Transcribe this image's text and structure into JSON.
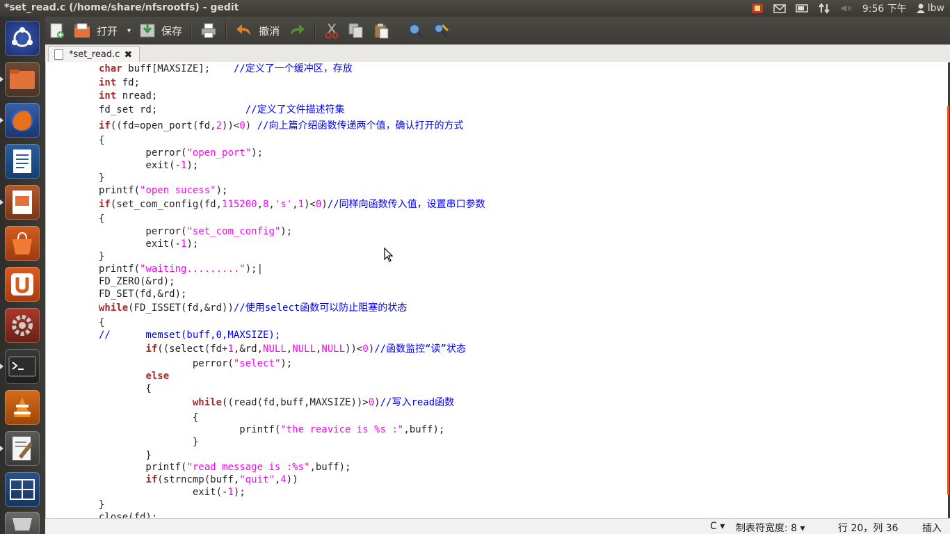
{
  "window": {
    "title": "*set_read.c (/home/share/nfsrootfs) - gedit"
  },
  "tray": {
    "time": "9:56 下午",
    "user": "lbw"
  },
  "toolbar": {
    "open_label": "打开",
    "save_label": "保存",
    "undo_label": "撤消"
  },
  "tab": {
    "name": "*set_read.c"
  },
  "code_lines": [
    {
      "tokens": [
        {
          "t": "char",
          "c": "kw"
        },
        {
          "t": " buff[MAXSIZE];    ",
          "c": ""
        },
        {
          "t": "//定义了一个缓冲区，存放",
          "c": "cm"
        }
      ]
    },
    {
      "tokens": [
        {
          "t": "int",
          "c": "kw"
        },
        {
          "t": " fd;",
          "c": ""
        }
      ]
    },
    {
      "tokens": [
        {
          "t": "int",
          "c": "kw"
        },
        {
          "t": " nread;",
          "c": ""
        }
      ]
    },
    {
      "tokens": [
        {
          "t": "fd_set rd;               ",
          "c": ""
        },
        {
          "t": "//定义了文件描述符集",
          "c": "cm"
        }
      ]
    },
    {
      "tokens": [
        {
          "t": "if",
          "c": "kw"
        },
        {
          "t": "((fd=open_port(fd,",
          "c": ""
        },
        {
          "t": "2",
          "c": "num"
        },
        {
          "t": "))<",
          "c": ""
        },
        {
          "t": "0",
          "c": "num"
        },
        {
          "t": ") ",
          "c": ""
        },
        {
          "t": "//向上篇介绍函数传递两个值，确认打开的方式",
          "c": "cm"
        }
      ]
    },
    {
      "tokens": [
        {
          "t": "{",
          "c": ""
        }
      ]
    },
    {
      "tokens": [
        {
          "t": "        perror(",
          "c": ""
        },
        {
          "t": "\"open_port\"",
          "c": "str"
        },
        {
          "t": ");",
          "c": ""
        }
      ]
    },
    {
      "tokens": [
        {
          "t": "        exit(-",
          "c": ""
        },
        {
          "t": "1",
          "c": "num"
        },
        {
          "t": ");",
          "c": ""
        }
      ]
    },
    {
      "tokens": [
        {
          "t": "}",
          "c": ""
        }
      ]
    },
    {
      "tokens": [
        {
          "t": "printf(",
          "c": ""
        },
        {
          "t": "\"open sucess\"",
          "c": "str"
        },
        {
          "t": ");",
          "c": ""
        }
      ]
    },
    {
      "tokens": [
        {
          "t": "if",
          "c": "kw"
        },
        {
          "t": "(set_com_config(fd,",
          "c": ""
        },
        {
          "t": "115200",
          "c": "num"
        },
        {
          "t": ",",
          "c": ""
        },
        {
          "t": "8",
          "c": "num"
        },
        {
          "t": ",",
          "c": ""
        },
        {
          "t": "'s'",
          "c": "str"
        },
        {
          "t": ",",
          "c": ""
        },
        {
          "t": "1",
          "c": "num"
        },
        {
          "t": ")<",
          "c": ""
        },
        {
          "t": "0",
          "c": "num"
        },
        {
          "t": ")",
          "c": ""
        },
        {
          "t": "//同样向函数传入值，设置串口参数",
          "c": "cm"
        }
      ]
    },
    {
      "tokens": [
        {
          "t": "{",
          "c": ""
        }
      ]
    },
    {
      "tokens": [
        {
          "t": "        perror(",
          "c": ""
        },
        {
          "t": "\"set_com_config\"",
          "c": "str"
        },
        {
          "t": ");",
          "c": ""
        }
      ]
    },
    {
      "tokens": [
        {
          "t": "        exit(-",
          "c": ""
        },
        {
          "t": "1",
          "c": "num"
        },
        {
          "t": ");",
          "c": ""
        }
      ]
    },
    {
      "tokens": [
        {
          "t": "}",
          "c": ""
        }
      ]
    },
    {
      "tokens": [
        {
          "t": "printf(",
          "c": ""
        },
        {
          "t": "\"waiting.........\"",
          "c": "str"
        },
        {
          "t": ");|",
          "c": ""
        }
      ]
    },
    {
      "tokens": [
        {
          "t": "FD_ZERO(&rd);",
          "c": ""
        }
      ]
    },
    {
      "tokens": [
        {
          "t": "FD_SET(fd,&rd);",
          "c": ""
        }
      ]
    },
    {
      "tokens": [
        {
          "t": "while",
          "c": "kw"
        },
        {
          "t": "(FD_ISSET(fd,&rd))",
          "c": ""
        },
        {
          "t": "//使用select函数可以防止阻塞的状态",
          "c": "cm"
        }
      ]
    },
    {
      "tokens": [
        {
          "t": "{",
          "c": ""
        }
      ]
    },
    {
      "tokens": [
        {
          "t": "//      memset(buff,0,MAXSIZE);",
          "c": "cm"
        }
      ]
    },
    {
      "tokens": [
        {
          "t": "        ",
          "c": ""
        },
        {
          "t": "if",
          "c": "kw"
        },
        {
          "t": "((select(fd+",
          "c": ""
        },
        {
          "t": "1",
          "c": "num"
        },
        {
          "t": ",&rd,",
          "c": ""
        },
        {
          "t": "NULL",
          "c": "num"
        },
        {
          "t": ",",
          "c": ""
        },
        {
          "t": "NULL",
          "c": "num"
        },
        {
          "t": ",",
          "c": ""
        },
        {
          "t": "NULL",
          "c": "num"
        },
        {
          "t": "))<",
          "c": ""
        },
        {
          "t": "0",
          "c": "num"
        },
        {
          "t": ")",
          "c": ""
        },
        {
          "t": "//函数监控“读”状态",
          "c": "cm"
        }
      ]
    },
    {
      "tokens": [
        {
          "t": "                perror(",
          "c": ""
        },
        {
          "t": "\"select\"",
          "c": "str"
        },
        {
          "t": ");",
          "c": ""
        }
      ]
    },
    {
      "tokens": [
        {
          "t": "        ",
          "c": ""
        },
        {
          "t": "else",
          "c": "kw"
        }
      ]
    },
    {
      "tokens": [
        {
          "t": "        {",
          "c": ""
        }
      ]
    },
    {
      "tokens": [
        {
          "t": "                ",
          "c": ""
        },
        {
          "t": "while",
          "c": "kw"
        },
        {
          "t": "((read(fd,buff,MAXSIZE))>",
          "c": ""
        },
        {
          "t": "0",
          "c": "num"
        },
        {
          "t": ")",
          "c": ""
        },
        {
          "t": "//写入read函数",
          "c": "cm"
        }
      ]
    },
    {
      "tokens": [
        {
          "t": "                {",
          "c": ""
        }
      ]
    },
    {
      "tokens": [
        {
          "t": "                        printf(",
          "c": ""
        },
        {
          "t": "\"the reavice is %s :\"",
          "c": "str"
        },
        {
          "t": ",buff);",
          "c": ""
        }
      ]
    },
    {
      "tokens": [
        {
          "t": "                }",
          "c": ""
        }
      ]
    },
    {
      "tokens": [
        {
          "t": "        }",
          "c": ""
        }
      ]
    },
    {
      "tokens": [
        {
          "t": "        printf(",
          "c": ""
        },
        {
          "t": "\"read message is :%s\"",
          "c": "str"
        },
        {
          "t": ",buff);",
          "c": ""
        }
      ]
    },
    {
      "tokens": [
        {
          "t": "        ",
          "c": ""
        },
        {
          "t": "if",
          "c": "kw"
        },
        {
          "t": "(strncmp(buff,",
          "c": ""
        },
        {
          "t": "\"quit\"",
          "c": "str"
        },
        {
          "t": ",",
          "c": ""
        },
        {
          "t": "4",
          "c": "num"
        },
        {
          "t": "))",
          "c": ""
        }
      ]
    },
    {
      "tokens": [
        {
          "t": "                exit(-",
          "c": ""
        },
        {
          "t": "1",
          "c": "num"
        },
        {
          "t": ");",
          "c": ""
        }
      ]
    },
    {
      "tokens": [
        {
          "t": "}",
          "c": ""
        }
      ]
    },
    {
      "tokens": [
        {
          "t": "close(fd);",
          "c": ""
        }
      ]
    }
  ],
  "status": {
    "language": "C ▾",
    "tab_width": "制表符宽度: 8 ▾",
    "position": "行 20，列 36",
    "mode": "插入"
  }
}
